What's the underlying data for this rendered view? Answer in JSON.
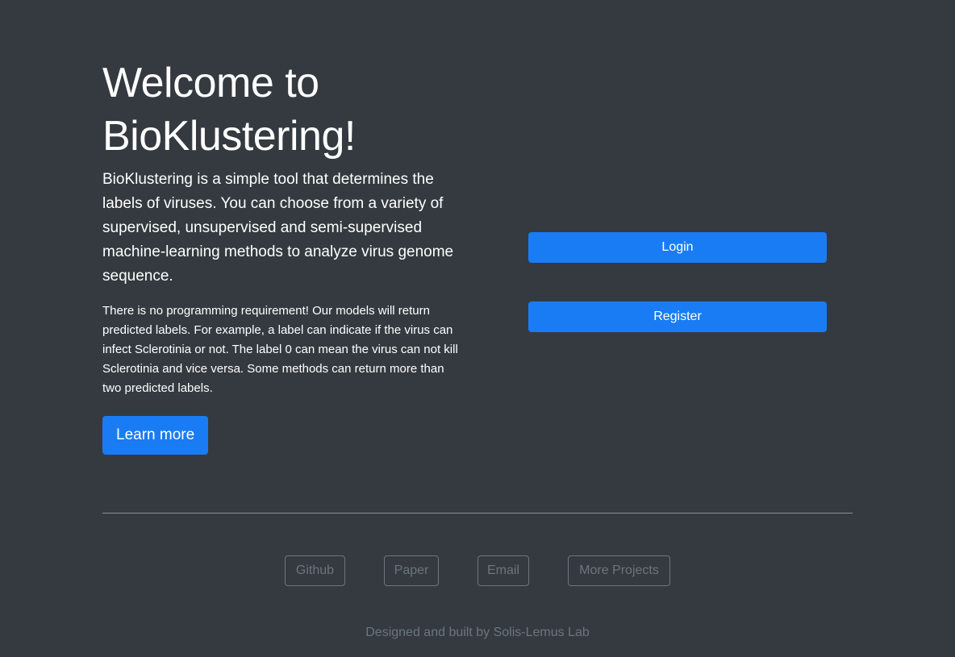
{
  "hero": {
    "title": "Welcome to BioKlustering!",
    "lead": "BioKlustering is a simple tool that determines the labels of viruses. You can choose from a variety of supervised, unsupervised and semi-supervised machine-learning methods to analyze virus genome sequence.",
    "description": "There is no programming requirement! Our models will return predicted labels. For example, a label can indicate if the virus can infect Sclerotinia or not. The label 0 can mean the virus can not kill Sclerotinia and vice versa. Some methods can return more than two predicted labels.",
    "learn_more": "Learn more"
  },
  "auth": {
    "login": "Login",
    "register": "Register"
  },
  "links": [
    "Github",
    "Paper",
    "Email",
    "More Projects"
  ],
  "footer": "Designed and built by Solis-Lemus Lab",
  "colors": {
    "background": "#343a40",
    "primary": "#1a7cf5",
    "muted": "#6c757d"
  }
}
